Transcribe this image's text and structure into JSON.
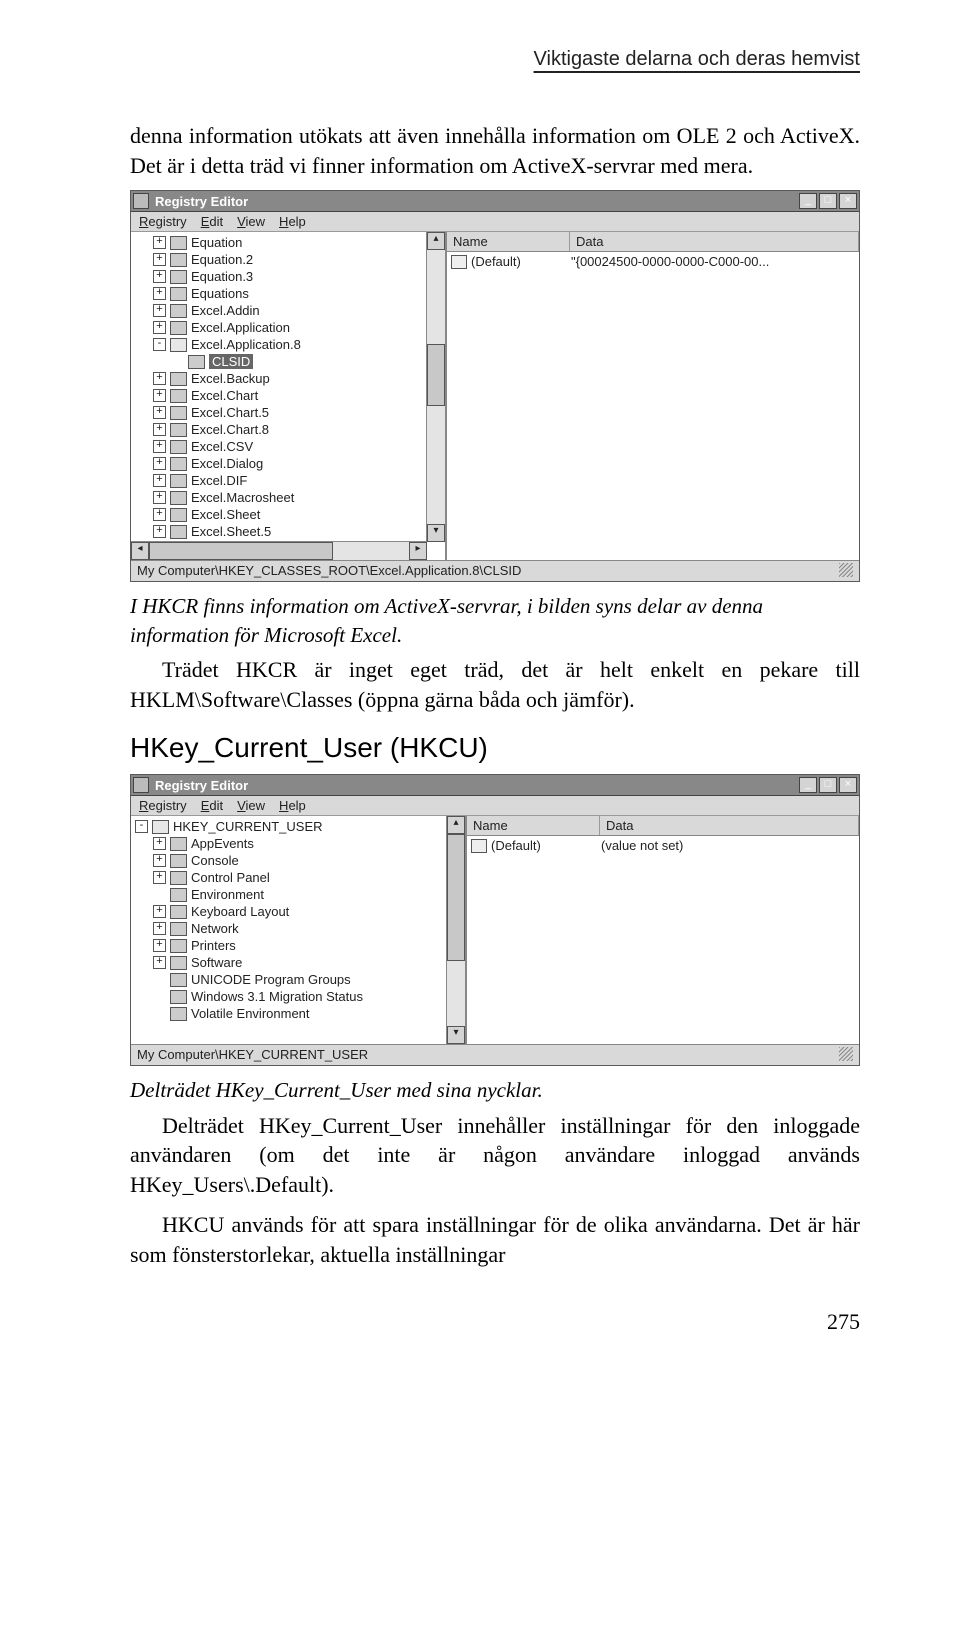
{
  "running_head": "Viktigaste delarna och deras hemvist",
  "para1": "denna information utökats att även innehålla information om OLE 2 och ActiveX. Det är i detta träd vi finner information om ActiveX-servrar med mera.",
  "caption1": "I HKCR finns information om ActiveX-servrar, i bilden syns delar av denna information för Microsoft Excel.",
  "para2": "Trädet HKCR är inget eget träd, det är helt enkelt en pekare till HKLM\\Software\\Classes (öppna gärna båda och jämför).",
  "section2": "HKey_Current_User (HKCU)",
  "caption2": "Delträdet HKey_Current_User med sina nycklar.",
  "para3": "Delträdet HKey_Current_User innehåller inställningar för den inloggade användaren (om det inte är någon användare inloggad används HKey_Users\\.Default).",
  "para4": "HKCU används för att spara inställningar för de olika användarna. Det är här som fönsterstorlekar, aktuella inställningar",
  "page_number": "275",
  "win": {
    "title": "Registry Editor",
    "menus": [
      "Registry",
      "Edit",
      "View",
      "Help"
    ],
    "cols": {
      "name": "Name",
      "data": "Data"
    },
    "row_default": "(Default)",
    "value_not_set": "(value not set)",
    "btn_min": "_",
    "btn_max": "□",
    "btn_close": "×"
  },
  "shot1": {
    "tree": [
      {
        "ind": 1,
        "exp": "+",
        "label": "Equation"
      },
      {
        "ind": 1,
        "exp": "+",
        "label": "Equation.2"
      },
      {
        "ind": 1,
        "exp": "+",
        "label": "Equation.3"
      },
      {
        "ind": 1,
        "exp": "+",
        "label": "Equations"
      },
      {
        "ind": 1,
        "exp": "+",
        "label": "Excel.Addin"
      },
      {
        "ind": 1,
        "exp": "+",
        "label": "Excel.Application"
      },
      {
        "ind": 1,
        "exp": "-",
        "label": "Excel.Application.8",
        "open": true
      },
      {
        "ind": 2,
        "exp": "",
        "label": "CLSID",
        "sel": true
      },
      {
        "ind": 1,
        "exp": "+",
        "label": "Excel.Backup"
      },
      {
        "ind": 1,
        "exp": "+",
        "label": "Excel.Chart"
      },
      {
        "ind": 1,
        "exp": "+",
        "label": "Excel.Chart.5"
      },
      {
        "ind": 1,
        "exp": "+",
        "label": "Excel.Chart.8"
      },
      {
        "ind": 1,
        "exp": "+",
        "label": "Excel.CSV"
      },
      {
        "ind": 1,
        "exp": "+",
        "label": "Excel.Dialog"
      },
      {
        "ind": 1,
        "exp": "+",
        "label": "Excel.DIF"
      },
      {
        "ind": 1,
        "exp": "+",
        "label": "Excel.Macrosheet"
      },
      {
        "ind": 1,
        "exp": "+",
        "label": "Excel.Sheet"
      },
      {
        "ind": 1,
        "exp": "+",
        "label": "Excel.Sheet.5"
      }
    ],
    "data_value": "\"{00024500-0000-0000-C000-00...",
    "status": "My Computer\\HKEY_CLASSES_ROOT\\Excel.Application.8\\CLSID"
  },
  "shot2": {
    "tree": [
      {
        "ind": 0,
        "exp": "-",
        "label": "HKEY_CURRENT_USER",
        "open": true
      },
      {
        "ind": 1,
        "exp": "+",
        "label": "AppEvents"
      },
      {
        "ind": 1,
        "exp": "+",
        "label": "Console"
      },
      {
        "ind": 1,
        "exp": "+",
        "label": "Control Panel"
      },
      {
        "ind": 1,
        "exp": "",
        "label": "Environment"
      },
      {
        "ind": 1,
        "exp": "+",
        "label": "Keyboard Layout"
      },
      {
        "ind": 1,
        "exp": "+",
        "label": "Network"
      },
      {
        "ind": 1,
        "exp": "+",
        "label": "Printers"
      },
      {
        "ind": 1,
        "exp": "+",
        "label": "Software"
      },
      {
        "ind": 1,
        "exp": "",
        "label": "UNICODE Program Groups"
      },
      {
        "ind": 1,
        "exp": "",
        "label": "Windows 3.1 Migration Status"
      },
      {
        "ind": 1,
        "exp": "",
        "label": "Volatile Environment"
      }
    ],
    "status": "My Computer\\HKEY_CURRENT_USER"
  }
}
